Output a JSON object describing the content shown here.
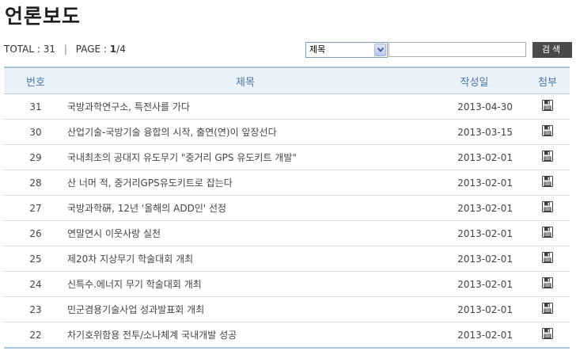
{
  "page": {
    "title": "언론보도"
  },
  "summary": {
    "total_label": "TOTAL",
    "total_value": "31",
    "separator": "|",
    "page_label": "PAGE",
    "page_current": "1",
    "page_total": "/4"
  },
  "search": {
    "field_selected": "제목",
    "query_value": "",
    "button_label": "검색"
  },
  "table": {
    "headers": [
      "번호",
      "제목",
      "작성일",
      "첨부"
    ],
    "rows": [
      {
        "no": "31",
        "subject": "국방과학연구소, 특전사를 가다",
        "date": "2013-04-30",
        "attach_icon": "floppy-disk-icon"
      },
      {
        "no": "30",
        "subject": "산업기술-국방기술 융합의 시작, 출연(연)이 앞장선다",
        "date": "2013-03-15",
        "attach_icon": "floppy-disk-icon"
      },
      {
        "no": "29",
        "subject": "국내최초의 공대지 유도무기 \"중거리 GPS 유도키트 개발\"",
        "date": "2013-02-01",
        "attach_icon": "floppy-disk-icon"
      },
      {
        "no": "28",
        "subject": "산 너머 적, 중거리GPS유도키트로 잡는다",
        "date": "2013-02-01",
        "attach_icon": "floppy-disk-icon"
      },
      {
        "no": "27",
        "subject": "국방과학硏, 12년 '올해의 ADD인' 선정",
        "date": "2013-02-01",
        "attach_icon": "floppy-disk-icon"
      },
      {
        "no": "26",
        "subject": "연말연시 이웃사랑 실천",
        "date": "2013-02-01",
        "attach_icon": "floppy-disk-icon"
      },
      {
        "no": "25",
        "subject": "제20차 지상무기 학술대회 개최",
        "date": "2013-02-01",
        "attach_icon": "floppy-disk-icon"
      },
      {
        "no": "24",
        "subject": "신특수.에너지 무기 학술대회 개최",
        "date": "2013-02-01",
        "attach_icon": "floppy-disk-icon"
      },
      {
        "no": "23",
        "subject": "민군겸용기술사업 성과발표회 개최",
        "date": "2013-02-01",
        "attach_icon": "floppy-disk-icon"
      },
      {
        "no": "22",
        "subject": "차기호위함용 전투/소나체계 국내개발 성공",
        "date": "2013-02-01",
        "attach_icon": "floppy-disk-icon"
      }
    ]
  }
}
